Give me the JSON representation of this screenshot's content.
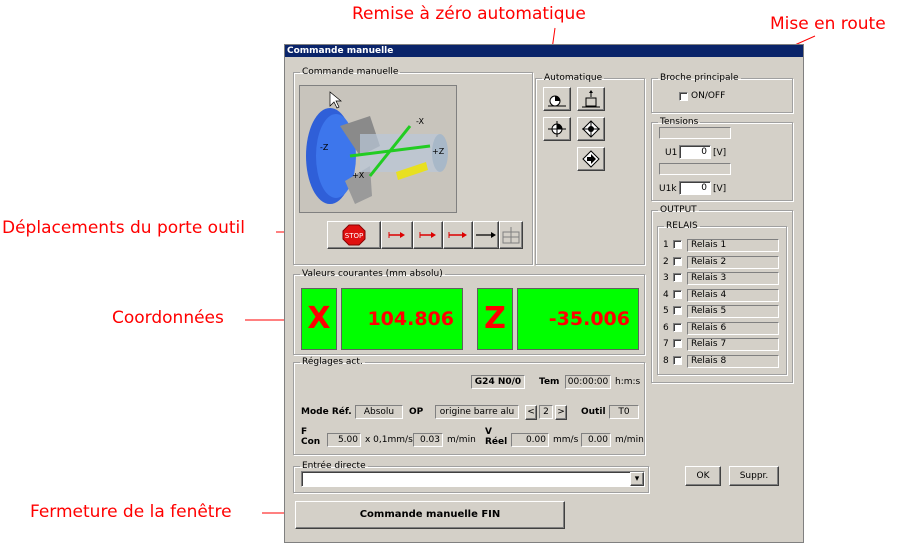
{
  "annotations": {
    "remise": "Remise à zéro automatique",
    "mise": "Mise en route",
    "deplacements": "Déplacements du porte outil",
    "coordonnees": "Coordonnées",
    "fermeture": "Fermeture de la fenêtre"
  },
  "window": {
    "title": "Commande manuelle"
  },
  "manuelle": {
    "legend": "Commande manuelle",
    "stop_label": "STOP",
    "axis_labels": [
      "-X",
      "-Z",
      "+Z",
      "+X"
    ]
  },
  "automatique": {
    "legend": "Automatique"
  },
  "broche": {
    "legend": "Broche principale",
    "toggle_label": "ON/OFF"
  },
  "tensions": {
    "legend": "Tensions",
    "u1_label": "U1",
    "u1_value": "0",
    "u1_unit": "[V]",
    "u1k_label": "U1k",
    "u1k_value": "0",
    "u1k_unit": "[V]"
  },
  "output": {
    "legend": "OUTPUT",
    "relais_legend": "RELAIS",
    "relais": [
      {
        "num": "1",
        "label": "Relais 1"
      },
      {
        "num": "2",
        "label": "Relais 2"
      },
      {
        "num": "3",
        "label": "Relais 3"
      },
      {
        "num": "4",
        "label": "Relais 4"
      },
      {
        "num": "5",
        "label": "Relais 5"
      },
      {
        "num": "6",
        "label": "Relais 6"
      },
      {
        "num": "7",
        "label": "Relais 7"
      },
      {
        "num": "8",
        "label": "Relais 8"
      }
    ]
  },
  "valeurs": {
    "legend": "Valeurs courantes (mm absolu)",
    "x_label": "X",
    "x_value": "104.806",
    "z_label": "Z",
    "z_value": "-35.006"
  },
  "reglages": {
    "legend": "Réglages act.",
    "g_code": "G24 N0/0",
    "tem_label": "Tem",
    "tem_value": "00:00:00",
    "tem_unit": "h:m:s",
    "mode_label": "Mode Réf.",
    "mode_value": "Absolu",
    "op_label": "OP",
    "op_value": "origine barre alu",
    "op_prev": "<",
    "op_index": "2",
    "op_next": ">",
    "outil_label": "Outil",
    "outil_value": "T0",
    "f_label": "F",
    "con_label": "Con",
    "f_value": "5.00",
    "f_unit": "x 0,1mm/s",
    "f_value2": "0.03",
    "f_unit2": "m/min",
    "v_label": "V",
    "reel_label": "Réel",
    "v_value": "0.00",
    "v_unit": "mm/s",
    "v_value2": "0.00",
    "v_unit2": "m/min"
  },
  "entree": {
    "legend": "Entrée directe",
    "value": ""
  },
  "buttons": {
    "ok": "OK",
    "suppr": "Suppr.",
    "fin": "Commande manuelle FIN"
  },
  "colors": {
    "display_bg": "#00ff00",
    "display_text": "#ff0000",
    "annotation": "#ff0000",
    "titlebar": "#0a246a"
  }
}
